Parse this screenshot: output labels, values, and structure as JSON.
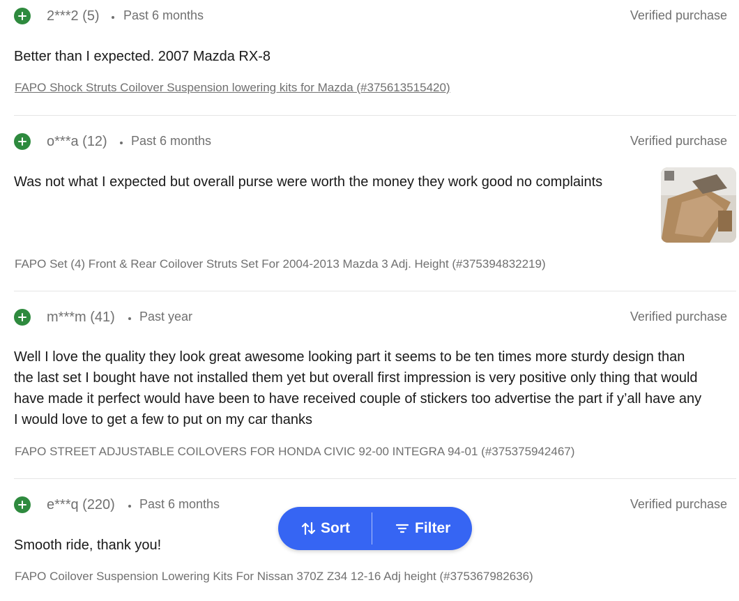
{
  "reviews": [
    {
      "user": "2***2 (5)",
      "time": "Past 6 months",
      "verified": "Verified purchase",
      "comment": "Better than I expected. 2007 Mazda RX-8",
      "item": "FAPO Shock Struts Coilover Suspension lowering kits for Mazda (#375613515420)"
    },
    {
      "user": "o***a (12)",
      "time": "Past 6 months",
      "verified": "Verified purchase",
      "comment": "Was not what I expected but overall purse were worth the money they work good no complaints",
      "item": "FAPO Set (4) Front & Rear Coilover Struts Set For 2004-2013 Mazda 3 Adj. Height (#375394832219)"
    },
    {
      "user": "m***m (41)",
      "time": "Past year",
      "verified": "Verified purchase",
      "comment_lines": [
        "Well I love the quality they look great awesome looking part it seems to be ten times more sturdy design than",
        "the last set I bought have not installed them yet but overall first impression is very positive only thing that would",
        "have made it perfect would have been to have received couple of stickers too advertise the part if y’all have any",
        "I would love to get a few to put on my car thanks"
      ],
      "item": "FAPO STREET ADJUSTABLE COILOVERS FOR HONDA CIVIC 92-00 INTEGRA 94-01 (#375375942467)"
    },
    {
      "user": "e***q (220)",
      "time": "Past 6 months",
      "verified": "Verified purchase",
      "comment": "Smooth ride, thank you!",
      "item": "FAPO Coilover Suspension Lowering Kits For Nissan 370Z Z34 12-16 Adj height (#375367982636)"
    }
  ],
  "toolbar": {
    "sort_label": "Sort",
    "filter_label": "Filter",
    "sort_icon": "sort-arrows-icon",
    "filter_icon": "filter-lines-icon"
  },
  "colors": {
    "accent": "#3665f3",
    "positive": "#2e8a3e",
    "muted_text": "#707070",
    "divider": "#e5e5e5"
  }
}
